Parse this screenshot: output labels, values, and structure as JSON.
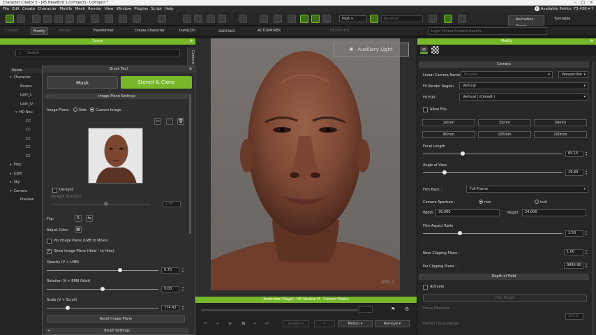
{
  "window": {
    "title": "Character Creator 5 - [R5 HeadBird 1.ccProject] - CcProject *"
  },
  "menu": [
    "File",
    "Edit",
    "Create",
    "Character",
    "Modify",
    "Mesh",
    "Render",
    "View",
    "Window",
    "Plugins",
    "Script",
    "Help"
  ],
  "menu_right": "Available Points: 73,438",
  "toolbar": {
    "quality": "High",
    "render_mode": "Iterative",
    "animation_player": "Animation Player",
    "turntable": "Turntable"
  },
  "toolbar2": {
    "content": "Content",
    "modify": "Modify",
    "morph": "Morph",
    "transformer": "Transformer",
    "create_character": "Create Character",
    "insta_lod": "InstaLOD",
    "substance": "SUBSTANCE",
    "actormixer": "ACTORMIXER",
    "headshot": "HEADSHOT",
    "login": "Login Online Content Search..."
  },
  "scene": {
    "title": "Scene",
    "search_placeholder": "Search",
    "column_name": "Name",
    "tree": [
      "Character",
      "Boxers",
      "Lash_L",
      "Lash_U",
      "HD Neu",
      "CC",
      "CC",
      "CC",
      "CC",
      "CC",
      "Prop",
      "Light",
      "Sky",
      "Camera",
      "Preview"
    ],
    "content_tab": "Content"
  },
  "brush_tool": {
    "title": "Brush Tool",
    "mask": "Mask",
    "stencil_clone": "Stencil & Clone",
    "image_plane_settings": "Image Plane Settings",
    "image_plane_label": "Image Plane:",
    "side": "Side",
    "custom_image": "Custom Image",
    "delight": "De-light",
    "delight_strength": "De-light Strength",
    "delight_value": "1.00",
    "flip": "Flip:",
    "adjust_color": "Adjust Color:",
    "pin_image_plane": "Pin Image Plane (LMB to Move)",
    "show_image_plane": "Show Image Plane (Hold ` to Hide)",
    "opacity_label": "Opacity (V + LMB)",
    "opacity_value": "0.70",
    "opacity": 0.7,
    "rotation_label": "Rotation (V + RMB Orbit)",
    "rotation_value": "0.00",
    "scale_label": "Scale (V + Scroll)",
    "scale_value": "174.42",
    "reset": "Reset Image Plane",
    "brush_settings": "Brush Settings"
  },
  "viewport": {
    "aux_light": "Auxiliary Light",
    "watermark": "DRG 0"
  },
  "animation_player": {
    "title": "Animation Player : HD Neutral M - Current Frame",
    "realtime": "Realtime",
    "motion": "Motion",
    "remove": "Remove"
  },
  "modify": {
    "title": "Modify",
    "camera_section": "Camera",
    "linear_camera_name": "Linear Camera Name:",
    "camera_name_placeholder": "Preview",
    "perspective": "Perspective",
    "fit_render_region": "Fit Render Region",
    "fit_render_value": "Vertical",
    "fit_fov": "Fit FOV :",
    "fit_fov_value": "Vertical ( iClone6 )",
    "allow_flip": "Allow Flip",
    "lenses": [
      "20mm",
      "35mm",
      "50mm",
      "80mm",
      "105mm",
      "200mm"
    ],
    "focal_length": "Focal Length",
    "focal_value": "69.15",
    "angle_of_view": "Angle of View",
    "angle_value": "19.69",
    "film_back": "Film Back :",
    "film_back_value": "Full-Frame",
    "camera_aperture": "Camera Aperture :",
    "mm": "mm",
    "inch": "inch",
    "width_label": "Width",
    "width_value": "36.000",
    "height_label": "Height",
    "height_value": "24.000",
    "film_aspect_ratio": "Film Aspect Ratio",
    "aspect_value": "1.50",
    "near_clip": "Near Clipping Plane :",
    "near_value": "1.00",
    "far_clip": "Far Clipping Plane :",
    "far_value": "9999.90",
    "dof_section": "Depth of Field",
    "activate": "Activate",
    "pick_target": "Pick Target",
    "focus_distance": "Focus Distance",
    "focus_value": "100.0",
    "perfect_focus_range": "Perfect Focus Range"
  },
  "colors": {
    "accent": "#76b82a",
    "panel": "#272727",
    "header": "#3b3b3b"
  }
}
